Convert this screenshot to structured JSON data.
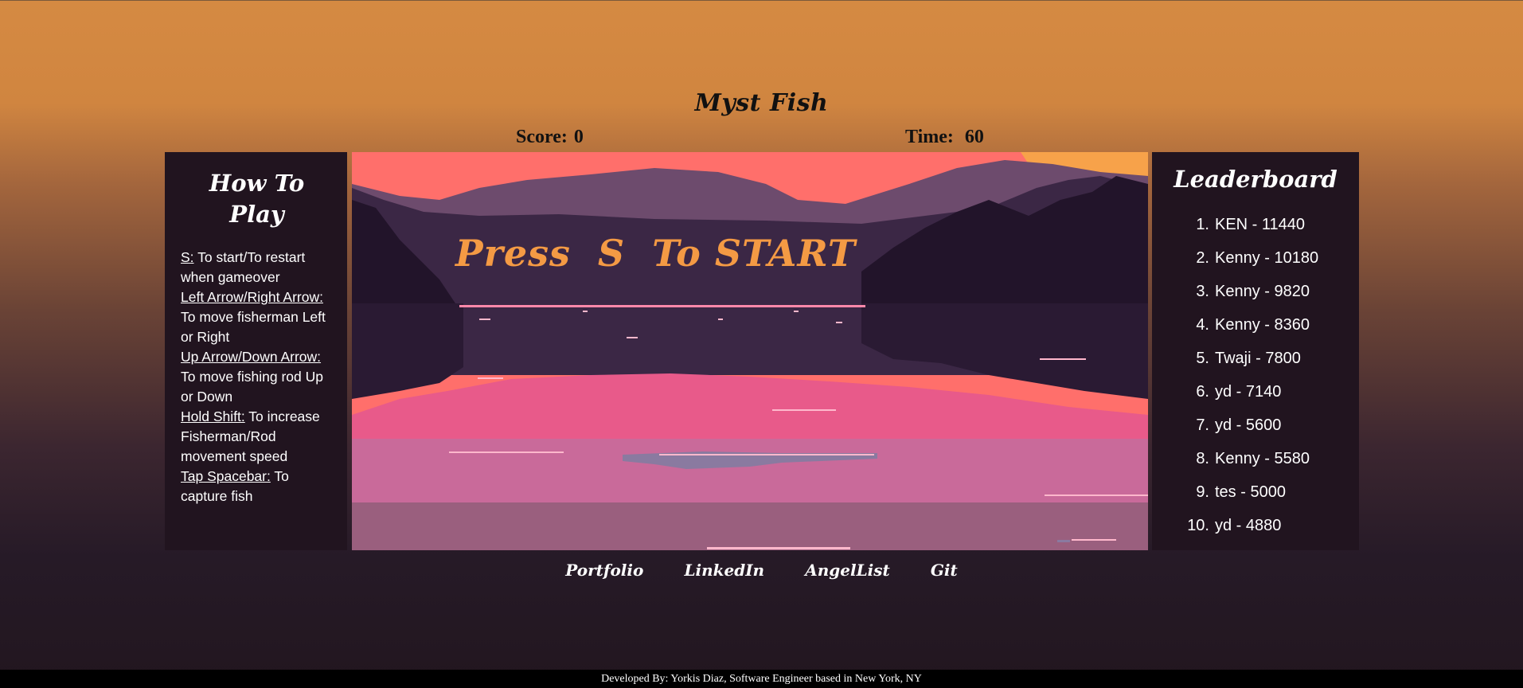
{
  "title": "Myst Fish",
  "score": {
    "label": "Score:",
    "value": "0"
  },
  "time": {
    "label": "Time:",
    "value": "60"
  },
  "howto": {
    "heading": "How To Play",
    "items": [
      {
        "key": "S:",
        "desc": "To start/To restart when gameover"
      },
      {
        "key": "Left Arrow/Right Arrow:",
        "desc": "To move fisherman Left or Right"
      },
      {
        "key": "Up Arrow/Down Arrow:",
        "desc": "To move fishing rod Up or Down"
      },
      {
        "key": "Hold Shift:",
        "desc": "To increase Fisherman/Rod movement speed"
      },
      {
        "key": "Tap Spacebar:",
        "desc": "To capture fish"
      }
    ]
  },
  "game": {
    "prompt": "Press  S  To START"
  },
  "leaderboard": {
    "heading": "Leaderboard",
    "entries": [
      {
        "rank": "1.",
        "text": "KEN - 11440"
      },
      {
        "rank": "2.",
        "text": "Kenny - 10180"
      },
      {
        "rank": "3.",
        "text": "Kenny - 9820"
      },
      {
        "rank": "4.",
        "text": "Kenny - 8360"
      },
      {
        "rank": "5.",
        "text": "Twaji - 7800"
      },
      {
        "rank": "6.",
        "text": "yd - 7140"
      },
      {
        "rank": "7.",
        "text": "yd - 5600"
      },
      {
        "rank": "8.",
        "text": "Kenny - 5580"
      },
      {
        "rank": "9.",
        "text": "tes - 5000"
      },
      {
        "rank": "10.",
        "text": "yd - 4880"
      }
    ]
  },
  "links": {
    "portfolio": "Portfolio",
    "linkedin": "LinkedIn",
    "angellist": "AngelList",
    "git": "Git"
  },
  "footer": "Developed By: Yorkis Diaz, Software Engineer based in New York, NY",
  "colors": {
    "accent": "#f49a44",
    "panel": "#21141f",
    "sky": "#ff6f6b",
    "water_pink": "#e85a8a"
  }
}
